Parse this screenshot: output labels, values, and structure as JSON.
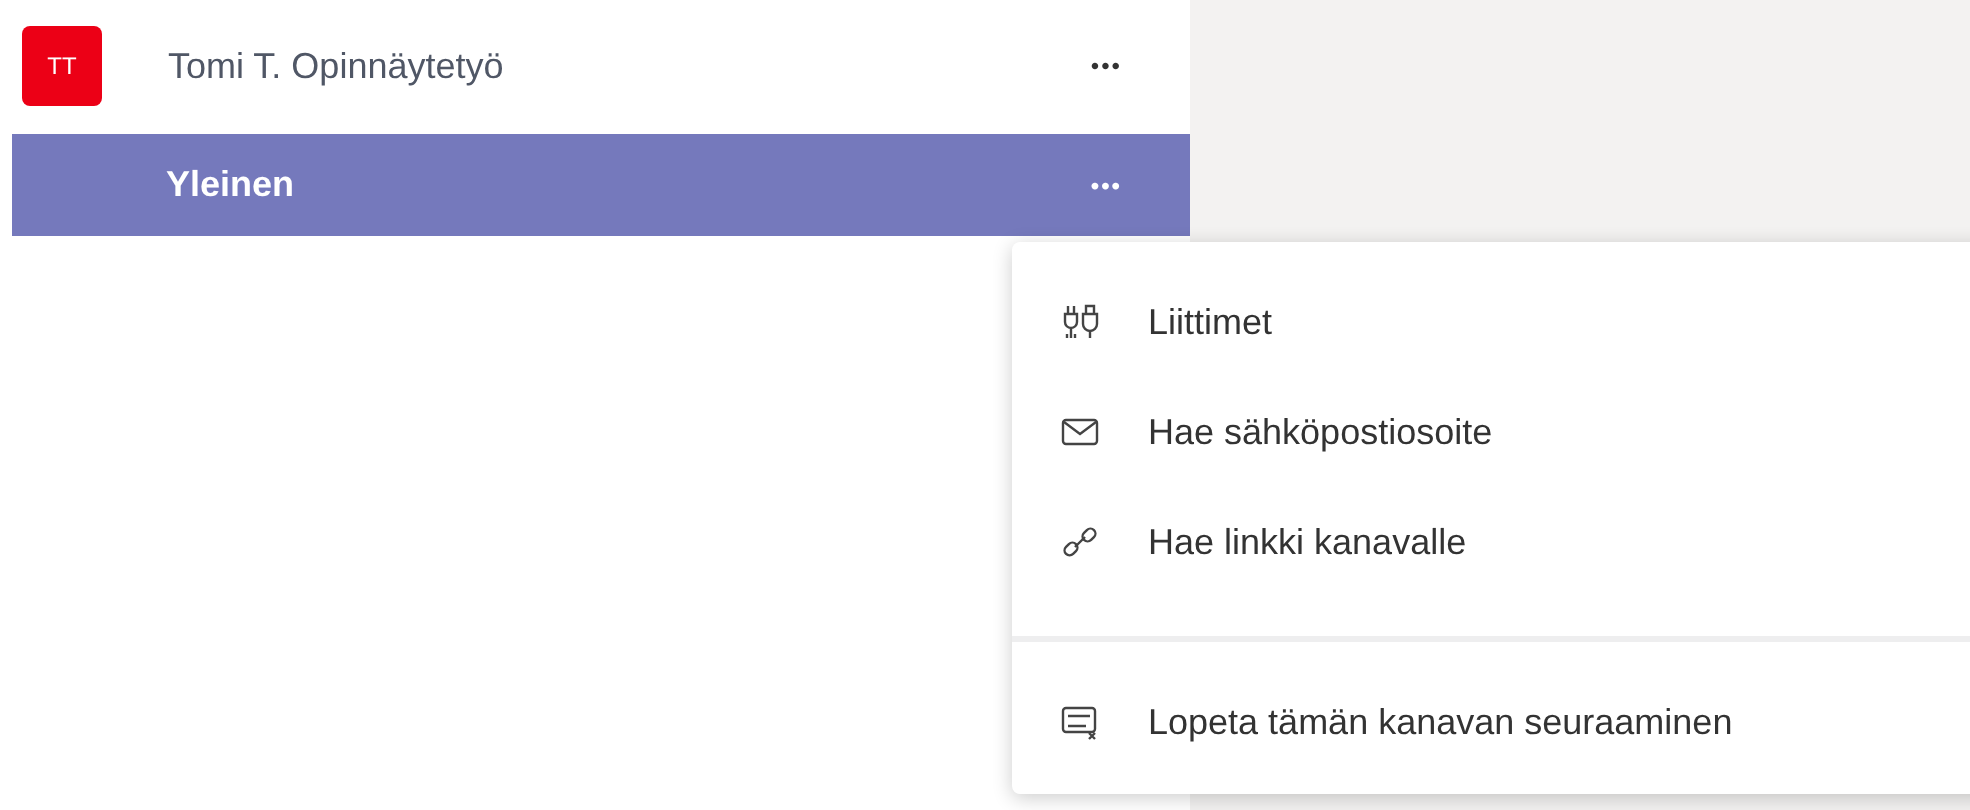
{
  "team": {
    "avatar": "TT",
    "name": "Tomi T. Opinnäytetyö",
    "more": "•••"
  },
  "channels": [
    {
      "name": "Yleinen",
      "selected": true,
      "more": "•••"
    }
  ],
  "menu": {
    "groups": [
      {
        "items": [
          {
            "kind": "connectors",
            "label": "Liittimet"
          },
          {
            "kind": "email",
            "label": "Hae sähköpostiosoite"
          },
          {
            "kind": "link",
            "label": "Hae linkki kanavalle"
          }
        ]
      },
      {
        "items": [
          {
            "kind": "unfollow",
            "label": "Lopeta tämän kanavan seuraaminen"
          }
        ]
      }
    ]
  }
}
